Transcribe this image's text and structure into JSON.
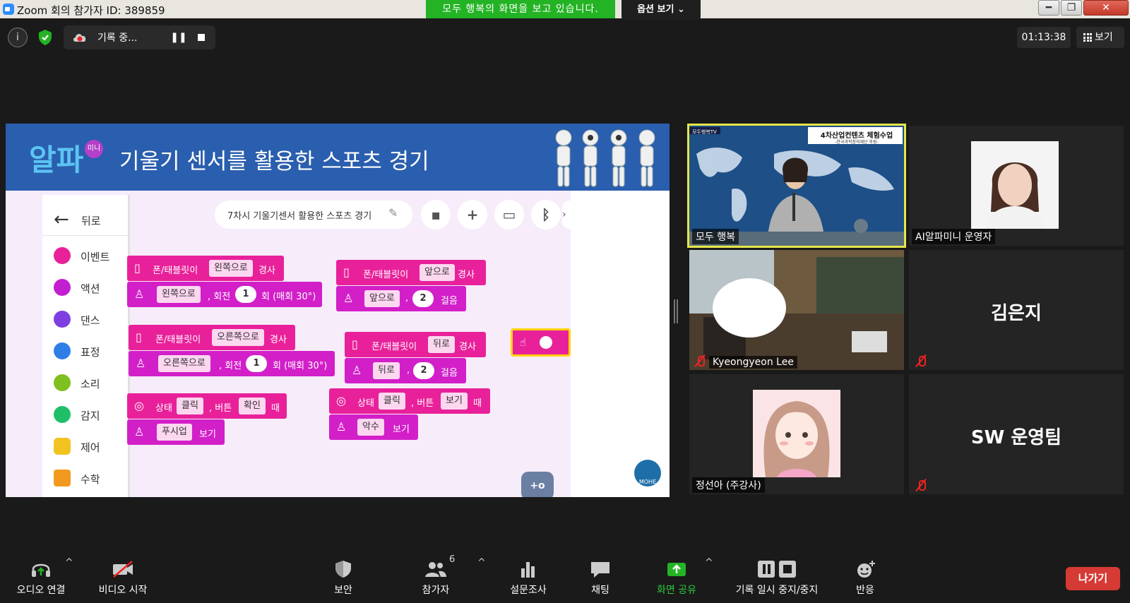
{
  "window": {
    "title": "Zoom 회의 참가자 ID: 389859",
    "share_banner": "모두 행복의 화면을 보고 있습니다.",
    "view_options": "옵션 보기",
    "minimize": "━",
    "maximize": "❐",
    "close": "✕"
  },
  "topbar": {
    "recording_label": "기록 중...",
    "pause_glyph": "❚❚",
    "timer": "01:13:38",
    "view_label": "보기"
  },
  "slide": {
    "logo": "알파",
    "logo_badge": "미니",
    "title": "기울기 센서를 활용한 스포츠 경기"
  },
  "app": {
    "back_label": "뒤로",
    "categories": [
      {
        "label": "이벤트",
        "color": "#e8219a"
      },
      {
        "label": "액션",
        "color": "#c21fd1"
      },
      {
        "label": "댄스",
        "color": "#7f3fe0"
      },
      {
        "label": "표정",
        "color": "#2f7ee8"
      },
      {
        "label": "소리",
        "color": "#7fbf1f"
      },
      {
        "label": "감지",
        "color": "#1fbf6a"
      },
      {
        "label": "제어",
        "color": "#f2c21f"
      },
      {
        "label": "수학",
        "color": "#f29a1f"
      }
    ],
    "project_name": "7차시 기울기센서 활용한 스포츠 경기",
    "blocks": {
      "b1_event": {
        "prefix": "폰/태블릿이",
        "pill": "왼쪽으로",
        "suffix": "경사"
      },
      "b1_action": {
        "pill": "왼쪽으로",
        "mid": ", 회전",
        "num": "1",
        "suffix": "회 (매회 30°)"
      },
      "b2_event": {
        "prefix": "폰/태블릿이",
        "pill": "오른쪽으로",
        "suffix": "경사"
      },
      "b2_action": {
        "pill": "오른쪽으로",
        "mid": ", 회전",
        "num": "1",
        "suffix": "회 (매회 30°)"
      },
      "b3_event": {
        "prefix": "상태",
        "pill": "클릭",
        "mid": ", 버튼",
        "pill2": "확인",
        "suffix": "때"
      },
      "b3_action": {
        "pill": "푸시업",
        "suffix": "보기"
      },
      "b4_event": {
        "prefix": "폰/태블릿이",
        "pill": "앞으로",
        "suffix": "경사"
      },
      "b4_action": {
        "pill": "앞으로",
        "mid": ",",
        "num": "2",
        "suffix": "걸음"
      },
      "b5_event": {
        "prefix": "폰/태블릿이",
        "pill": "뒤로",
        "suffix": "경사"
      },
      "b5_action": {
        "pill": "뒤로",
        "mid": ",",
        "num": "2",
        "suffix": "걸음"
      },
      "b6_event": {
        "prefix": "상태",
        "pill": "클릭",
        "mid": ", 버튼",
        "pill2": "보기",
        "suffix": "때"
      },
      "b6_action": {
        "pill": "악수",
        "suffix": "보기"
      }
    },
    "game_btn": "+o",
    "logo_text": "MOHE"
  },
  "participants": [
    {
      "name": "모두 행복",
      "board_title": "4차산업컨텐츠 체험수업",
      "board_sub": "-한국과학창의재단 후원-",
      "board_tag": "모두행복TV"
    },
    {
      "name": "AI알파미니 운영자"
    },
    {
      "name": "Kyeongyeon Lee"
    },
    {
      "name": "김은지"
    },
    {
      "name": "정선아 (주강사)"
    },
    {
      "name": "SW 운영팀"
    }
  ],
  "toolbar": {
    "audio": "오디오 연결",
    "video": "비디오 시작",
    "security": "보안",
    "participants": "참가자",
    "participant_count": "6",
    "polls": "설문조사",
    "chat": "채팅",
    "share": "화면 공유",
    "record": "기록 일시 중지/중지",
    "reactions": "반응",
    "leave": "나가기",
    "caret": "^"
  },
  "colors": {
    "share_green": "#24b324",
    "leave_red": "#d63a34",
    "active_speaker": "#e6e64a",
    "block_pink": "#e8219a",
    "header_blue": "#2a5eae"
  }
}
